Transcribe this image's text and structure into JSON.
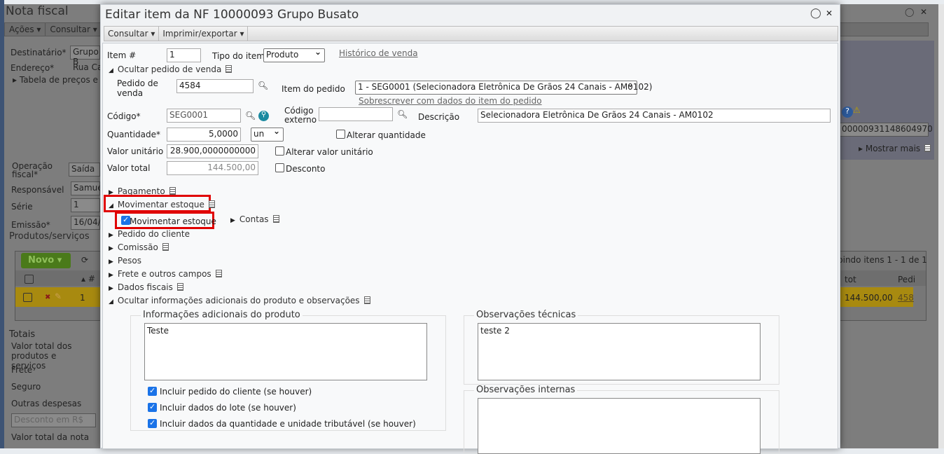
{
  "background": {
    "title": "Nota fiscal",
    "menu": [
      "Ações",
      "Consultar"
    ],
    "fields": {
      "destinatario_label": "Destinatário*",
      "destinatario_value": "Grupo B",
      "endereco_label": "Endereço*",
      "endereco_value": "Rua Ca",
      "tabela_label": "Tabela de preços e re",
      "operacao_label": "Operação fiscal*",
      "operacao_value": "Saída",
      "responsavel_label": "Responsável",
      "responsavel_value": "Samuel",
      "serie_label": "Série",
      "serie_value": "1",
      "emissao_label": "Emissão*",
      "emissao_value": "16/04/2"
    },
    "key_value": "00000931148604970",
    "mostrar_mais": "Mostrar mais",
    "produtos_title": "Produtos/serviços",
    "novo_label": "Novo",
    "grid": {
      "paging": "bindo itens 1 - 1 de 1",
      "col_num": "#",
      "col_total": "tot",
      "col_pedido": "Pedi",
      "row_num": "1",
      "row_total": "144.500,00",
      "row_pedido": "458"
    },
    "totais": {
      "title": "Totais",
      "items": [
        "Valor total dos produtos e serviços",
        "Frete",
        "Seguro",
        "Outras despesas"
      ],
      "desconto_select": "Desconto em R$",
      "valor_total_nota": "Valor total da nota"
    }
  },
  "modal": {
    "title": "Editar item da NF 10000093 Grupo Busato",
    "menu": [
      "Consultar",
      "Imprimir/exportar"
    ],
    "item_label": "Item #",
    "item_value": "1",
    "tipo_label": "Tipo do item",
    "tipo_value": "Produto",
    "historico_link": "Histórico de venda",
    "ocultar_pedido": "Ocultar pedido de venda",
    "pedido_label": "Pedido de venda",
    "pedido_value": "4584",
    "item_pedido_label": "Item do pedido",
    "item_pedido_value": "1 - SEG0001 (Selecionadora Eletrônica De Grãos 24 Canais - AM0102)",
    "sobrescrever_link": "Sobrescrever com dados do item do pedido",
    "codigo_label": "Código*",
    "codigo_value": "SEG0001",
    "codigo_externo_label": "Código externo",
    "codigo_externo_value": "",
    "descricao_label": "Descrição",
    "descricao_value": "Selecionadora Eletrônica De Grãos 24 Canais - AM0102",
    "quantidade_label": "Quantidade*",
    "quantidade_value": "5,0000",
    "unidade_value": "un",
    "alterar_quantidade": "Alterar quantidade",
    "valor_unitario_label": "Valor unitário",
    "valor_unitario_value": "28.900,0000000000",
    "alterar_valor_unitario": "Alterar valor unitário",
    "valor_total_label": "Valor total",
    "valor_total_value": "144.500,00",
    "desconto": "Desconto",
    "sections": {
      "pagamento": "Pagamento",
      "movimentar_estoque": "Movimentar estoque",
      "movimentar_estoque_cb": "Movimentar estoque",
      "contas": "Contas",
      "pedido_cliente": "Pedido do cliente",
      "comissao": "Comissão",
      "pesos": "Pesos",
      "frete": "Frete e outros campos",
      "dados_fiscais": "Dados fiscais",
      "ocultar_info": "Ocultar informações adicionais do produto e observações"
    },
    "info_adicionais": {
      "legend": "Informações adicionais do produto",
      "value": "Teste",
      "checks": [
        "Incluir pedido do cliente (se houver)",
        "Incluir dados do lote (se houver)",
        "Incluir dados da quantidade e unidade tributável (se houver)"
      ]
    },
    "obs_tecnicas": {
      "legend": "Observações técnicas",
      "value": "teste 2"
    },
    "obs_internas": {
      "legend": "Observações internas",
      "value": ""
    }
  },
  "colors": {
    "highlight": "#e00000",
    "checkbox": "#1a73e8",
    "row_selected": "#a88a10",
    "novo_button": "#4a7a1a"
  }
}
